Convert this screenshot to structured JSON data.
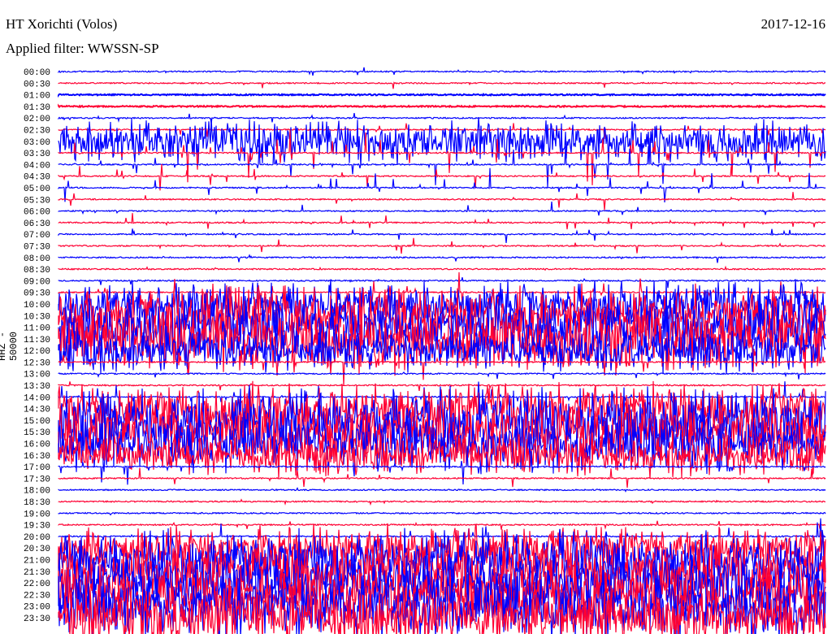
{
  "header": {
    "station": "HT Xorichti (Volos)",
    "date": "2017-12-16",
    "filter": "Applied filter: WWSSN-SP"
  },
  "chart_data": {
    "type": "line",
    "title": "HT Xorichti (Volos)",
    "ylabel": "HHZ - 50000",
    "colors": [
      "#0000ff",
      "#ff0033"
    ],
    "rows": [
      "00:00",
      "00:30",
      "01:00",
      "01:30",
      "02:00",
      "02:30",
      "03:00",
      "03:30",
      "04:00",
      "04:30",
      "05:00",
      "05:30",
      "06:00",
      "06:30",
      "07:00",
      "07:30",
      "08:00",
      "08:30",
      "09:00",
      "09:30",
      "10:00",
      "10:30",
      "11:00",
      "11:30",
      "12:00",
      "12:30",
      "13:00",
      "13:30",
      "14:00",
      "14:30",
      "15:00",
      "15:30",
      "16:00",
      "16:30",
      "17:00",
      "17:30",
      "18:00",
      "18:30",
      "19:00",
      "19:30",
      "20:00",
      "20:30",
      "21:00",
      "21:30",
      "22:00",
      "22:30",
      "23:00",
      "23:30"
    ],
    "relative_activity": [
      0.1,
      0.1,
      0,
      0,
      0.1,
      0.15,
      0.6,
      0.5,
      0.4,
      0.2,
      0.3,
      0.2,
      0.15,
      0.2,
      0.2,
      0.15,
      0.1,
      0.05,
      0.1,
      0.3,
      0.6,
      0.8,
      0.9,
      0.9,
      0.6,
      0.4,
      0.1,
      0.1,
      0.3,
      0.7,
      0.9,
      0.9,
      0.8,
      0.6,
      0.3,
      0.2,
      0.05,
      0.05,
      0.05,
      0.1,
      0.3,
      0.6,
      0.8,
      0.9,
      0.9,
      0.9,
      0.9,
      0.8
    ]
  }
}
